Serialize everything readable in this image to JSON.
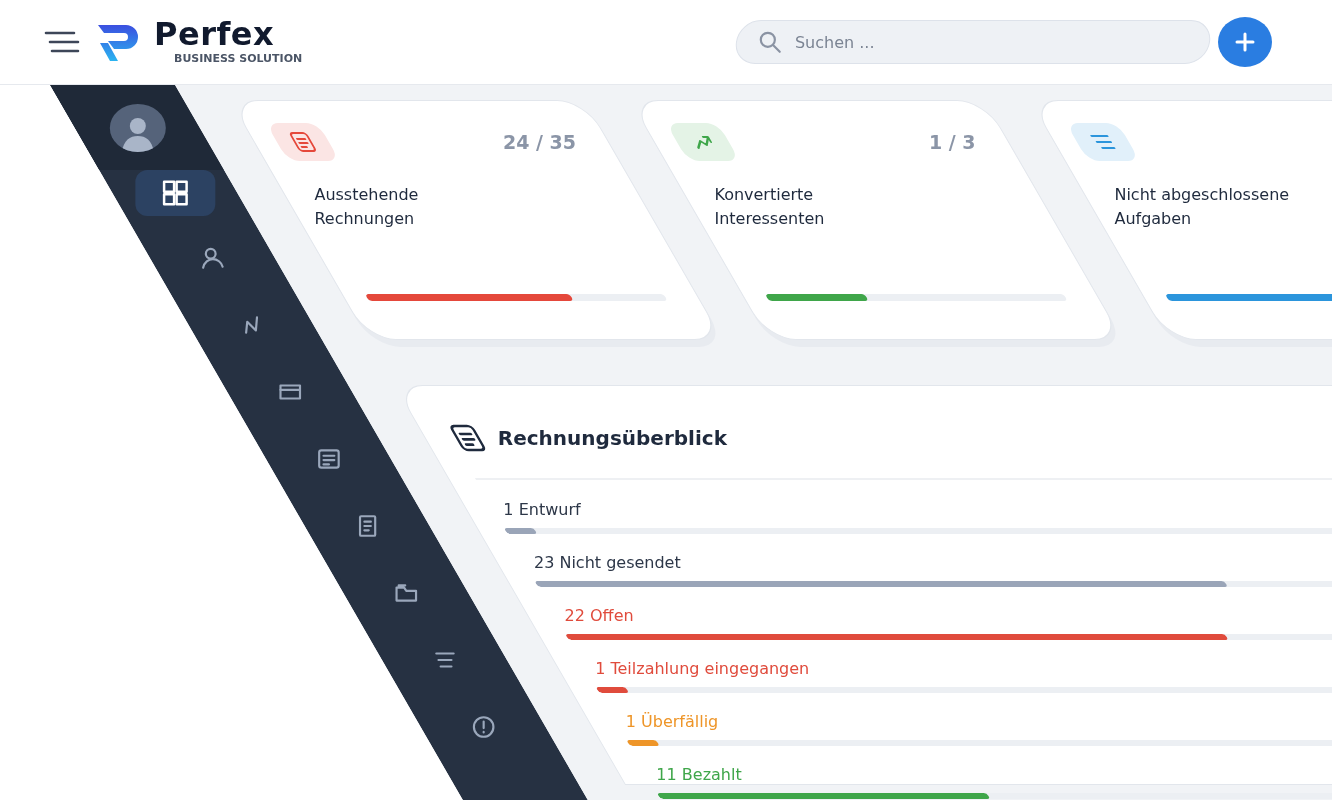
{
  "header": {
    "logo_title": "Perfex",
    "logo_subtitle": "BUSINESS SOLUTION",
    "search": {
      "placeholder": "Suchen ..."
    }
  },
  "sidebar": {
    "items": [
      {
        "kind": "dashboard",
        "selected": true
      },
      {
        "kind": "person",
        "selected": false
      },
      {
        "kind": "zigzag",
        "selected": false
      },
      {
        "kind": "card",
        "selected": false
      },
      {
        "kind": "document",
        "selected": false
      },
      {
        "kind": "page",
        "selected": false
      },
      {
        "kind": "folder",
        "selected": false
      },
      {
        "kind": "lines",
        "selected": false
      },
      {
        "kind": "info",
        "selected": false
      }
    ]
  },
  "stats": [
    {
      "kind": "invoice",
      "color": "#e5483b",
      "count": "24 / 35",
      "title": "Ausstehende Rechnungen",
      "level": 0.686
    },
    {
      "kind": "trend",
      "color": "#3fa64a",
      "count": "1 / 3",
      "title": "Konvertierte Interessenten",
      "level": 0.333
    },
    {
      "kind": "tasks",
      "color": "#2b95dc",
      "title": "Nicht abgeschlossene Aufgaben",
      "level": 0.6
    }
  ],
  "invoice_overview": {
    "title": "Rechnungsüberblick",
    "rows": [
      {
        "label": "1 Entwurf",
        "kind": "neutral",
        "level": 0.029
      },
      {
        "label": "23 Nicht gesendet",
        "kind": "neutral",
        "level": 0.657
      },
      {
        "label": "22 Offen",
        "kind": "danger",
        "level": 0.629
      },
      {
        "label": "1 Teilzahlung eingegangen",
        "kind": "danger",
        "level": 0.029
      },
      {
        "label": "1 Überfällig",
        "kind": "warning",
        "level": 0.029
      },
      {
        "label": "11 Bezahlt",
        "kind": "success",
        "level": 0.314
      }
    ]
  }
}
